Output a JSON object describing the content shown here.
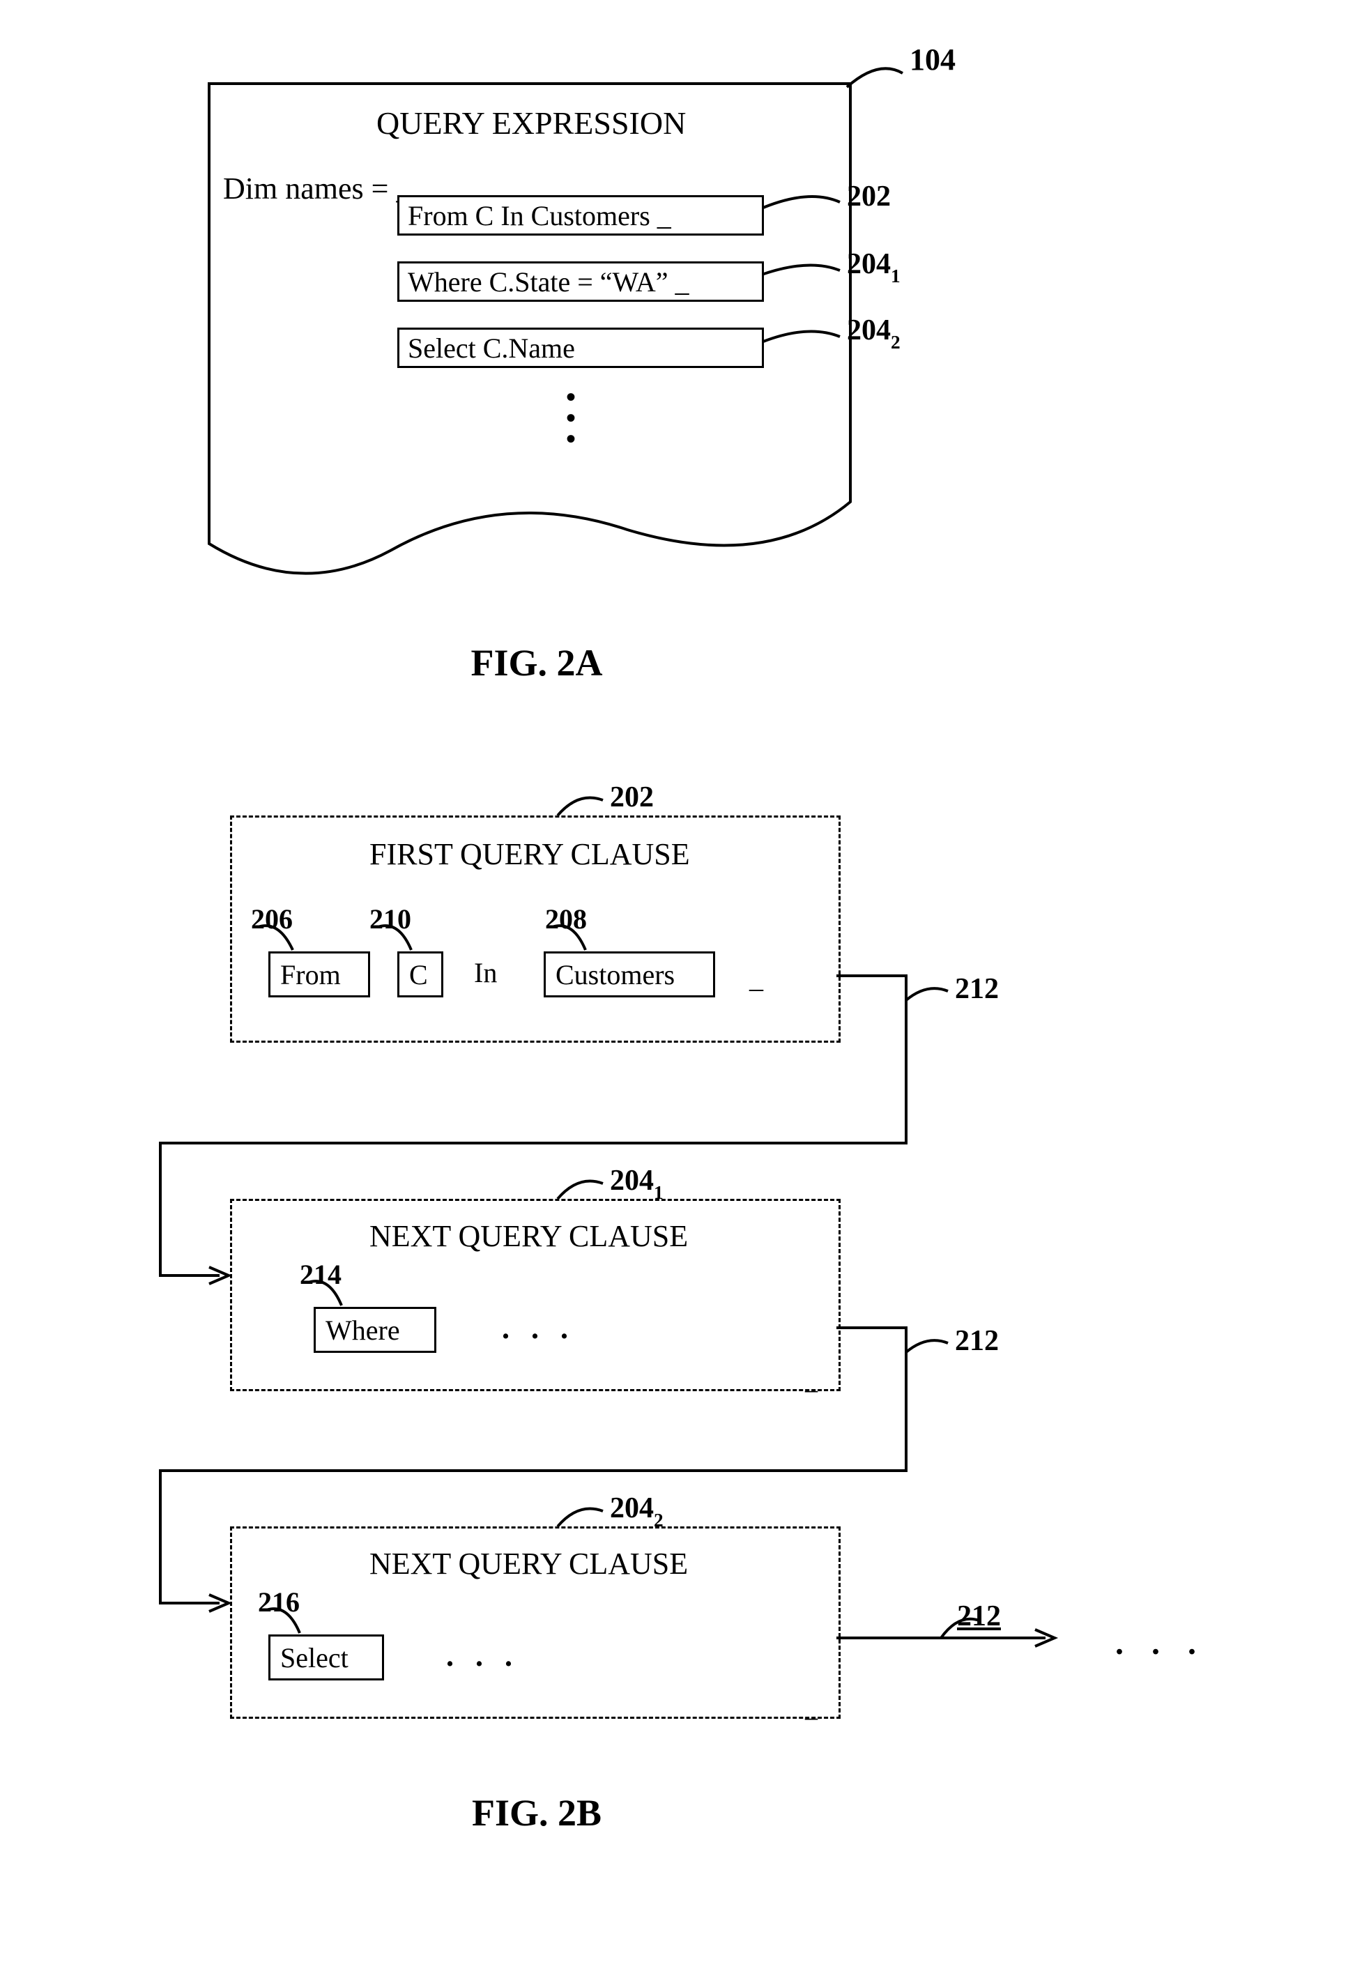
{
  "fig2a": {
    "ref_104": "104",
    "title": "QUERY EXPRESSION",
    "dim_line": "Dim names = _",
    "clause1_text": "From C In Customers _",
    "clause1_ref": "202",
    "clause2_text": "Where C.State = “WA” _",
    "clause3_text": "Select C.Name",
    "caption": "FIG. 2A"
  },
  "ref_204_base": "204",
  "sub_1": "1",
  "sub_2": "2",
  "fig2b": {
    "first_title": "FIRST QUERY CLAUSE",
    "first_ref": "202",
    "ref_206": "206",
    "ref_210": "210",
    "ref_208": "208",
    "ref_212": "212",
    "token_from": "From",
    "token_c": "C",
    "token_in": "In",
    "token_customers": "Customers",
    "underscore": "_",
    "next_title": "NEXT QUERY CLAUSE",
    "ref_214": "214",
    "token_where": "Where",
    "ellipsis3": ". . .",
    "ref_216": "216",
    "token_select": "Select",
    "caption": "FIG. 2B"
  }
}
